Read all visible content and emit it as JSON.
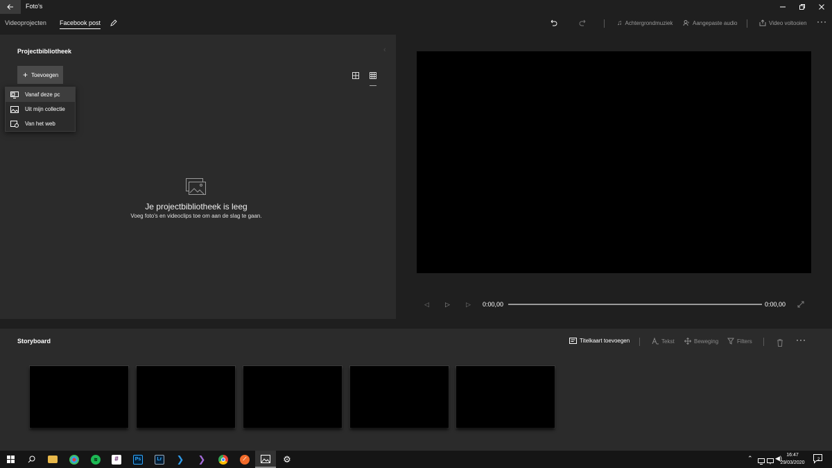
{
  "window": {
    "app_title": "Foto's"
  },
  "breadcrumb": {
    "parent": "Videoprojecten",
    "current": "Facebook post"
  },
  "toolbar": {
    "background_music": "Achtergrondmuziek",
    "custom_audio": "Aangepaste audio",
    "finish_video": "Video voltooien"
  },
  "library": {
    "title": "Projectbibliotheek",
    "add_label": "Toevoegen",
    "menu": [
      {
        "label": "Vanaf deze pc",
        "icon": "pc-icon"
      },
      {
        "label": "Uit mijn collectie",
        "icon": "collection-icon"
      },
      {
        "label": "Van het web",
        "icon": "web-icon"
      }
    ],
    "empty_title": "Je projectbibliotheek is leeg",
    "empty_subtitle": "Voeg foto's en videoclips toe om aan de slag te gaan."
  },
  "player": {
    "current_time": "0:00,00",
    "total_time": "0:00,00",
    "progress": 0
  },
  "storyboard": {
    "title": "Storyboard",
    "title_card": "Titelkaart toevoegen",
    "text": "Tekst",
    "motion": "Beweging",
    "filters": "Filters",
    "slot_count": 5
  },
  "taskbar": {
    "time": "16:47",
    "date": "29/03/2020",
    "notifications": "2",
    "apps": [
      "start",
      "search",
      "file-explorer",
      "davinci-resolve",
      "spotify",
      "slack",
      "photoshop",
      "lightroom",
      "vscode",
      "visual-studio",
      "chrome",
      "safari-like",
      "photos",
      "settings"
    ]
  },
  "colors": {
    "panel": "#2b2b2b",
    "background": "#1f1f1f",
    "taskbar": "#151515"
  }
}
